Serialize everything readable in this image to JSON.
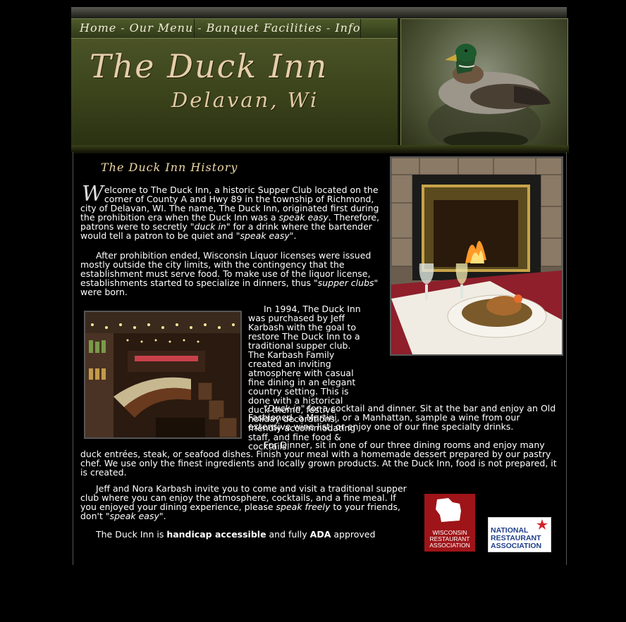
{
  "nav": {
    "items": [
      "Home",
      "Our Menu",
      "Banquet Facilities",
      "Info"
    ],
    "separator": "-"
  },
  "banner": {
    "title": "The Duck Inn",
    "subtitle": "Delavan, Wi"
  },
  "history": {
    "title": "The Duck Inn History",
    "dropcap": "W",
    "p1_parts": [
      "elcome to The Duck Inn, a historic Supper Club located on the corner of County A and Hwy 89 in the township of Richmond, city of Delavan, WI. The name, The Duck Inn, originated first during the prohibition era when the Duck Inn was a ",
      "speak easy",
      ". Therefore, patrons were to secretly ",
      "\"duck in\"",
      " for a drink where the bartender would tell a patron to be quiet and ",
      "\"speak easy\"",
      "."
    ],
    "p2_parts": [
      "After prohibition ended, Wisconsin Liquor licenses were issued mostly outside the city limits, with the contingency that the establishment must serve food. To make use of the liquor license, establishments started to specialize in dinners, thus ",
      "\"supper clubs\"",
      " were born."
    ],
    "p3": "In 1994, The Duck Inn was purchased by Jeff Karbash with the goal to restore The Duck Inn to a traditional supper club. The Karbash Family created an inviting atmosphere with casual fine dining in an elegant country setting. This is done with a historical duck theme, festive holiday decorations, friendly accommodating staff, and fine food & cocktails.",
    "p4_parts": [
      "\"Duck in\"",
      " for a cocktail and dinner. Sit at the bar and enjoy an Old Fashioned, a Martini, or a Manhattan, sample a wine from our extensive wine list, or enjoy one of our fine specialty drinks."
    ],
    "p5": "For Dinner, sit in one of our three dining rooms and enjoy many duck entrées, steak, or seafood dishes. Finish your meal with a homemade dessert prepared by our pastry chef. We use only the finest ingredients and locally grown products. At the Duck Inn, food is not prepared, it is created.",
    "p6_parts": [
      "Jeff and Nora Karbash invite you to come and visit a traditional supper club where you can enjoy the atmosphere, cocktails, and a fine meal. If you enjoyed your dining experience, please ",
      "speak freely",
      " to your friends, don't ",
      "\"speak easy\"",
      "."
    ],
    "p7_parts": [
      "The Duck Inn is ",
      "handicap accessible",
      " and fully ",
      "ADA",
      " approved"
    ]
  },
  "logos": {
    "wra": "WISCONSIN RESTAURANT ASSOCIATION",
    "nra": "NATIONAL RESTAURANT ASSOCIATION"
  },
  "colors": {
    "background": "#000000",
    "olive": "#3c441c",
    "gold_text": "#e7ceaa",
    "wra_red": "#9e1418",
    "nra_blue": "#1f3f8a"
  }
}
